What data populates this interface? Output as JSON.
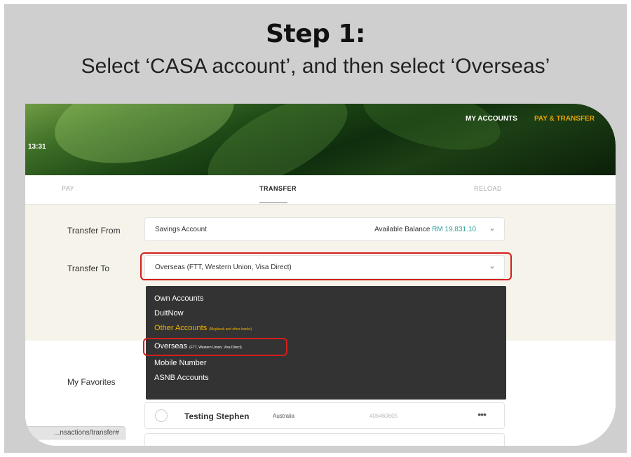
{
  "slide": {
    "title": "Step 1:",
    "subtitle": "Select ‘CASA account’, and then select ‘Overseas’"
  },
  "banner": {
    "clock": "13:31",
    "nav": {
      "my_accounts": "MY ACCOUNTS",
      "pay_transfer": "PAY & TRANSFER"
    }
  },
  "tabs": {
    "pay": "PAY",
    "transfer": "TRANSFER",
    "reload": "RELOAD",
    "active": "TRANSFER"
  },
  "form": {
    "transfer_from_label": "Transfer From",
    "transfer_from_value": "Savings Account",
    "balance_label": "Available Balance",
    "balance_value": "RM 19,831.10",
    "transfer_to_label": "Transfer To",
    "transfer_to_value": "Overseas (FTT, Western Union, Visa Direct)"
  },
  "dropdown": {
    "own_accounts": "Own Accounts",
    "duitnow": "DuitNow",
    "other_accounts": "Other Accounts",
    "other_accounts_note": "(Maybank and other banks)",
    "overseas": "Overseas",
    "overseas_note": "(FTT, Western Union, Visa Direct)",
    "mobile_number": "Mobile Number",
    "asnb_accounts": "ASNB Accounts",
    "selected": "Overseas"
  },
  "favorites": {
    "label": "My Favorites",
    "items": [
      {
        "name": "Testing Stephen",
        "country": "Australia",
        "account": "406460605",
        "more": "•••"
      }
    ]
  },
  "status_url": "...nsactions/transfer#",
  "colors": {
    "accent_gold": "#f2b400",
    "balance": "#2aa39a",
    "highlight": "#d41e1e",
    "menu_bg": "#333333"
  },
  "icons": {
    "chevron": "chevron-down-icon",
    "more": "more-icon",
    "radio": "radio-circle-icon"
  }
}
